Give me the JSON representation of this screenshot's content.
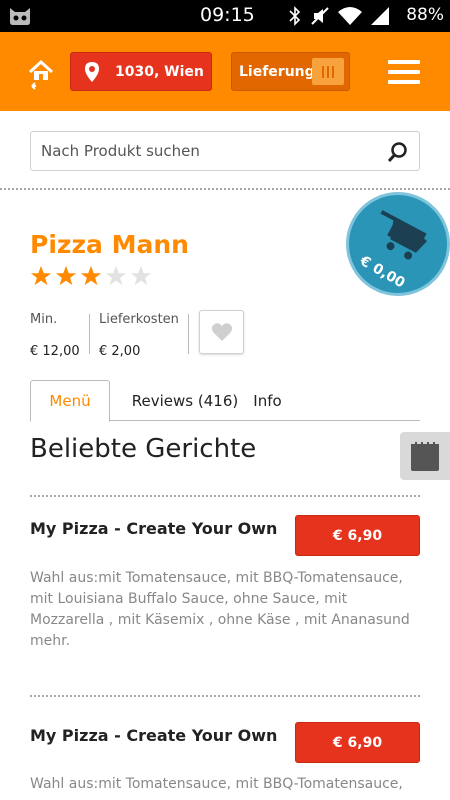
{
  "status_bar": {
    "time": "09:15",
    "battery": "88%"
  },
  "header": {
    "location_label": "1030, Wien",
    "delivery_label": "Lieferung",
    "brand_color": "#ff8a00"
  },
  "search": {
    "placeholder": "Nach Produkt suchen"
  },
  "restaurant": {
    "name": "Pizza Mann",
    "rating": 3,
    "rating_max": 5,
    "min_label": "Min.",
    "min_value": "€ 12,00",
    "delivery_cost_label": "Lieferkosten",
    "delivery_cost_value": "€ 2,00"
  },
  "cart": {
    "amount": "€ 0,00"
  },
  "tabs": [
    {
      "label": "Menü",
      "active": true
    },
    {
      "label": "Reviews (416)",
      "active": false
    },
    {
      "label": "Info",
      "active": false
    }
  ],
  "section_title": "Beliebte Gerichte",
  "dishes": [
    {
      "name": "My Pizza - Create Your Own",
      "price": "€ 6,90",
      "description": "Wahl aus:mit Tomatensauce, mit BBQ-Tomatensauce, mit Louisiana Buffalo Sauce, ohne Sauce, mit Mozzarella , mit Käsemix , ohne Käse , mit Ananasund mehr."
    },
    {
      "name": "My Pizza - Create Your Own",
      "price": "€ 6,90",
      "description": "Wahl aus:mit Tomatensauce, mit BBQ-Tomatensauce,"
    }
  ]
}
